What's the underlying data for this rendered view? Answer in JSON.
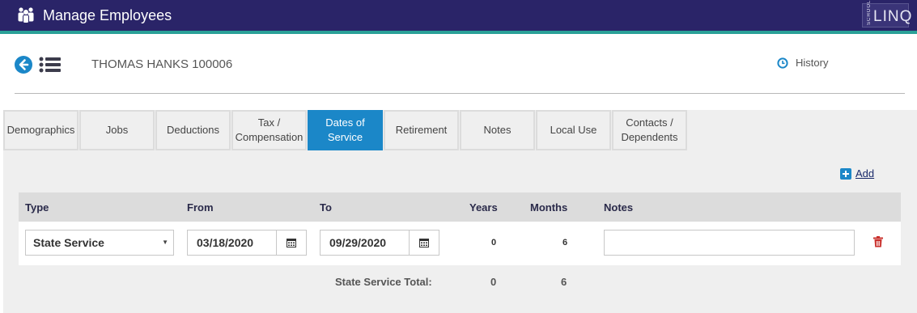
{
  "header": {
    "title": "Manage Employees",
    "logo_small": "SCHOOL",
    "logo_big": "LINQ",
    "colors": {
      "bar": "#2a2468",
      "accent": "#2aa198"
    }
  },
  "employee": {
    "name": "THOMAS HANKS 100006"
  },
  "history_label": "History",
  "tabs": [
    {
      "label": "Demographics",
      "active": false
    },
    {
      "label": "Jobs",
      "active": false
    },
    {
      "label": "Deductions",
      "active": false
    },
    {
      "label": "Tax /\nCompensation",
      "active": false
    },
    {
      "label": "Dates of\nService",
      "active": true
    },
    {
      "label": "Retirement",
      "active": false
    },
    {
      "label": "Notes",
      "active": false
    },
    {
      "label": "Local Use",
      "active": false
    },
    {
      "label": "Contacts /\nDependents",
      "active": false
    }
  ],
  "add_label": "Add",
  "table": {
    "headers": {
      "type": "Type",
      "from": "From",
      "to": "To",
      "years": "Years",
      "months": "Months",
      "notes": "Notes"
    },
    "rows": [
      {
        "type": "State Service",
        "from": "03/18/2020",
        "to": "09/29/2020",
        "years": "0",
        "months": "6",
        "notes": ""
      }
    ]
  },
  "totals": {
    "label": "State Service Total:",
    "years": "0",
    "months": "6"
  },
  "icons": {
    "app": "employees-icon",
    "back": "back-arrow-icon",
    "list": "list-icon",
    "history": "clock-icon",
    "add": "plus-square-icon",
    "calendar": "calendar-icon",
    "delete": "trash-icon"
  },
  "colors": {
    "active_tab": "#1b87c8",
    "delete": "#c9302c",
    "add_icon": "#1b87c8"
  }
}
